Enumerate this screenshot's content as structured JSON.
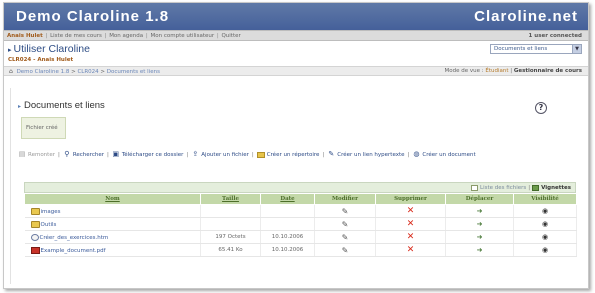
{
  "header": {
    "title": "Demo Claroline 1.8",
    "site": "Claroline.net"
  },
  "userbar": {
    "user": "Anais Hulet",
    "links": [
      "Liste de mes cours",
      "Mon agenda",
      "Mon compte utilisateur",
      "Quitter"
    ],
    "connected": "1 user connected"
  },
  "course": {
    "title": "Utiliser Claroline",
    "code": "CLR024 - Anais Hulet",
    "tool_select": "Documents et liens"
  },
  "breadcrumb": {
    "items": [
      "Demo Claroline 1.8",
      "CLR024",
      "Documents et liens"
    ],
    "separator": ">",
    "mode_label": "Mode de vue :",
    "mode_student": "Étudiant",
    "mode_manager": "Gestionnaire de cours"
  },
  "tool": {
    "title": "Documents et liens",
    "help_icon": "help-icon"
  },
  "message": "Fichier créé",
  "commands": [
    {
      "label": "Remonter",
      "icon": "up-folder-icon",
      "enabled": false
    },
    {
      "label": "Rechercher",
      "icon": "search-icon",
      "enabled": true
    },
    {
      "label": "Télécharger ce dossier",
      "icon": "download-icon",
      "enabled": true
    },
    {
      "label": "Ajouter un fichier",
      "icon": "add-file-icon",
      "enabled": true
    },
    {
      "label": "Créer un répertoire",
      "icon": "folder-icon",
      "enabled": true
    },
    {
      "label": "Créer un lien hypertexte",
      "icon": "link-icon",
      "enabled": true
    },
    {
      "label": "Créer un document",
      "icon": "document-icon",
      "enabled": true
    }
  ],
  "list_modes": {
    "list": "Liste des fichiers",
    "thumbnails": "Vignettes"
  },
  "table": {
    "columns": [
      "Nom",
      "Taille",
      "Date",
      "Modifier",
      "Supprimer",
      "Déplacer",
      "Visibilité"
    ],
    "rows": [
      {
        "name": "images",
        "type": "folder",
        "size": "",
        "date": ""
      },
      {
        "name": "Outils",
        "type": "folder",
        "size": "",
        "date": ""
      },
      {
        "name": "Créer_des_exercices.htm",
        "type": "htm",
        "size": "197 Octets",
        "date": "10.10.2006"
      },
      {
        "name": "Example_document.pdf",
        "type": "pdf",
        "size": "65.41 Ko",
        "date": "10.10.2006"
      }
    ]
  },
  "colors": {
    "banner": "#4f6aa0",
    "table_header": "#c3d8a8",
    "delete": "#d82818"
  }
}
